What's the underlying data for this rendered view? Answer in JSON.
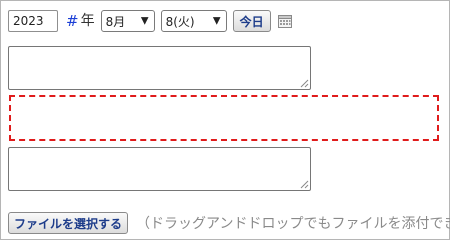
{
  "date": {
    "year_value": "2023",
    "hash_mark": "#",
    "year_suffix": "年",
    "month_selected": "8月",
    "day_selected": "8(火)",
    "today_label": "今日",
    "calendar_icon": "calendar-icon"
  },
  "attachments": {
    "select_file_label": "ファイルを選択する",
    "hint_text": "（ドラッグアンドドロップでもファイルを添付でき"
  },
  "colors": {
    "dropzone_border": "#e01b1b",
    "hash_color": "#1b3fd6",
    "button_text": "#1d3c8a"
  }
}
